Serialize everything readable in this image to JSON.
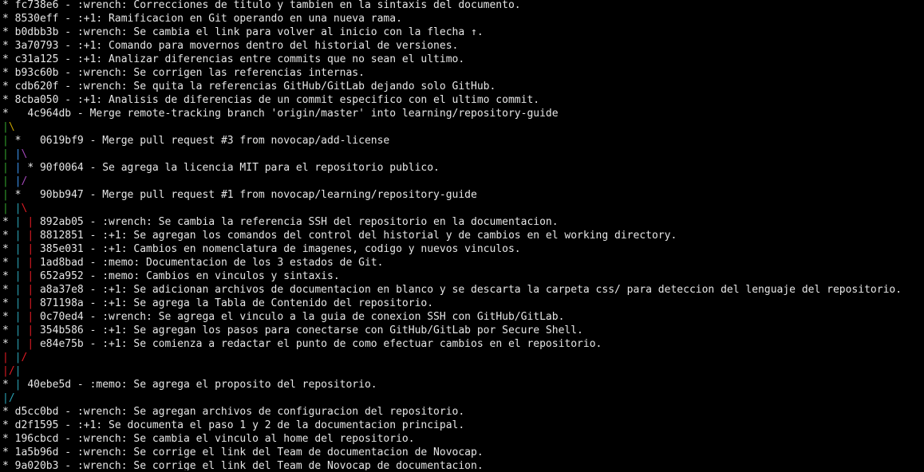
{
  "palette": {
    "red": "#e01b24",
    "green": "#33a02c",
    "yellow": "#c4a000",
    "blue": "#3a8ee6",
    "magenta": "#a347ba",
    "cyan": "#2aa1b3",
    "text": "#e6e6e6",
    "background": "#000000"
  },
  "lines": [
    {
      "graph": [
        [
          "white",
          "* "
        ]
      ],
      "text": "fc738e6 - :wrench: Correcciones de titulo y tambien en la sintaxis del documento."
    },
    {
      "graph": [
        [
          "white",
          "* "
        ]
      ],
      "text": "8530eff - :+1: Ramificacion en Git operando en una nueva rama."
    },
    {
      "graph": [
        [
          "white",
          "* "
        ]
      ],
      "text": "b0dbb3b - :wrench: Se cambia el link para volver al inicio con la flecha ↑."
    },
    {
      "graph": [
        [
          "white",
          "* "
        ]
      ],
      "text": "3a70793 - :+1: Comando para movernos dentro del historial de versiones."
    },
    {
      "graph": [
        [
          "white",
          "* "
        ]
      ],
      "text": "c31a125 - :+1: Analizar diferencias entre commits que no sean el ultimo."
    },
    {
      "graph": [
        [
          "white",
          "* "
        ]
      ],
      "text": "b93c60b - :wrench: Se corrigen las referencias internas."
    },
    {
      "graph": [
        [
          "white",
          "* "
        ]
      ],
      "text": "cdb620f - :wrench: Se quita la referencias GitHub/GitLab dejando solo GitHub."
    },
    {
      "graph": [
        [
          "white",
          "* "
        ]
      ],
      "text": "8cba050 - :+1: Analisis de diferencias de un commit especifico con el ultimo commit."
    },
    {
      "graph": [
        [
          "white",
          "*   "
        ]
      ],
      "text": "4c964db - Merge remote-tracking branch 'origin/master' into learning/repository-guide"
    },
    {
      "graph": [
        [
          "green",
          "|"
        ],
        [
          "yellow",
          "\\"
        ]
      ],
      "text": ""
    },
    {
      "graph": [
        [
          "green",
          "| "
        ],
        [
          "white",
          "*   "
        ]
      ],
      "text": "0619bf9 - Merge pull request #3 from novocap/add-license"
    },
    {
      "graph": [
        [
          "green",
          "| "
        ],
        [
          "blue",
          "|"
        ],
        [
          "magenta",
          "\\"
        ]
      ],
      "text": ""
    },
    {
      "graph": [
        [
          "green",
          "| "
        ],
        [
          "blue",
          "| "
        ],
        [
          "white",
          "* "
        ]
      ],
      "text": "90f0064 - Se agrega la licencia MIT para el repositorio publico."
    },
    {
      "graph": [
        [
          "green",
          "| "
        ],
        [
          "blue",
          "|"
        ],
        [
          "magenta",
          "/"
        ]
      ],
      "text": ""
    },
    {
      "graph": [
        [
          "green",
          "| "
        ],
        [
          "white",
          "*   "
        ]
      ],
      "text": "90bb947 - Merge pull request #1 from novocap/learning/repository-guide"
    },
    {
      "graph": [
        [
          "green",
          "| "
        ],
        [
          "cyan",
          "|"
        ],
        [
          "red",
          "\\"
        ]
      ],
      "text": ""
    },
    {
      "graph": [
        [
          "white",
          "* "
        ],
        [
          "cyan",
          "| "
        ],
        [
          "red",
          "| "
        ]
      ],
      "text": "892ab05 - :wrench: Se cambia la referencia SSH del repositorio en la documentacion."
    },
    {
      "graph": [
        [
          "white",
          "* "
        ],
        [
          "cyan",
          "| "
        ],
        [
          "red",
          "| "
        ]
      ],
      "text": "8812851 - :+1: Se agregan los comandos del control del historial y de cambios en el working directory."
    },
    {
      "graph": [
        [
          "white",
          "* "
        ],
        [
          "cyan",
          "| "
        ],
        [
          "red",
          "| "
        ]
      ],
      "text": "385e031 - :+1: Cambios en nomenclatura de imagenes, codigo y nuevos vinculos."
    },
    {
      "graph": [
        [
          "white",
          "* "
        ],
        [
          "cyan",
          "| "
        ],
        [
          "red",
          "| "
        ]
      ],
      "text": "1ad8bad - :memo: Documentacion de los 3 estados de Git."
    },
    {
      "graph": [
        [
          "white",
          "* "
        ],
        [
          "cyan",
          "| "
        ],
        [
          "red",
          "| "
        ]
      ],
      "text": "652a952 - :memo: Cambios en vinculos y sintaxis."
    },
    {
      "graph": [
        [
          "white",
          "* "
        ],
        [
          "cyan",
          "| "
        ],
        [
          "red",
          "| "
        ]
      ],
      "text": "a8a37e8 - :+1: Se adicionan archivos de documentacion en blanco y se descarta la carpeta css/ para deteccion del lenguaje del repositorio."
    },
    {
      "graph": [
        [
          "white",
          "* "
        ],
        [
          "cyan",
          "| "
        ],
        [
          "red",
          "| "
        ]
      ],
      "text": "871198a - :+1: Se agrega la Tabla de Contenido del repositorio."
    },
    {
      "graph": [
        [
          "white",
          "* "
        ],
        [
          "cyan",
          "| "
        ],
        [
          "red",
          "| "
        ]
      ],
      "text": "0c70ed4 - :wrench: Se agrega el vinculo a la guia de conexion SSH con GitHub/GitLab."
    },
    {
      "graph": [
        [
          "white",
          "* "
        ],
        [
          "cyan",
          "| "
        ],
        [
          "red",
          "| "
        ]
      ],
      "text": "354b586 - :+1: Se agregan los pasos para conectarse con GitHub/GitLab por Secure Shell."
    },
    {
      "graph": [
        [
          "white",
          "* "
        ],
        [
          "cyan",
          "| "
        ],
        [
          "red",
          "| "
        ]
      ],
      "text": "e84e75b - :+1: Se comienza a redactar el punto de como efectuar cambios en el repositorio."
    },
    {
      "graph": [
        [
          "red",
          "| "
        ],
        [
          "cyan",
          "|"
        ],
        [
          "red",
          "/"
        ]
      ],
      "text": ""
    },
    {
      "graph": [
        [
          "red",
          "|"
        ],
        [
          "red",
          "/"
        ],
        [
          "cyan",
          "|"
        ]
      ],
      "text": ""
    },
    {
      "graph": [
        [
          "white",
          "* "
        ],
        [
          "cyan",
          "| "
        ]
      ],
      "text": "40ebe5d - :memo: Se agrega el proposito del repositorio."
    },
    {
      "graph": [
        [
          "cyan",
          "|"
        ],
        [
          "cyan",
          "/"
        ]
      ],
      "text": ""
    },
    {
      "graph": [
        [
          "white",
          "* "
        ]
      ],
      "text": "d5cc0bd - :wrench: Se agregan archivos de configuracion del repositorio."
    },
    {
      "graph": [
        [
          "white",
          "* "
        ]
      ],
      "text": "d2f1595 - :+1: Se documenta el paso 1 y 2 de la documentacion principal."
    },
    {
      "graph": [
        [
          "white",
          "* "
        ]
      ],
      "text": "196cbcd - :wrench: Se cambia el vinculo al home del repositorio."
    },
    {
      "graph": [
        [
          "white",
          "* "
        ]
      ],
      "text": "1a5b96d - :wrench: Se corrige el link del Team de documentacion de Novocap."
    },
    {
      "graph": [
        [
          "white",
          "* "
        ]
      ],
      "text": "9a020b3 - :wrench: Se corrige el link del Team de Novocap de documentacion."
    }
  ]
}
